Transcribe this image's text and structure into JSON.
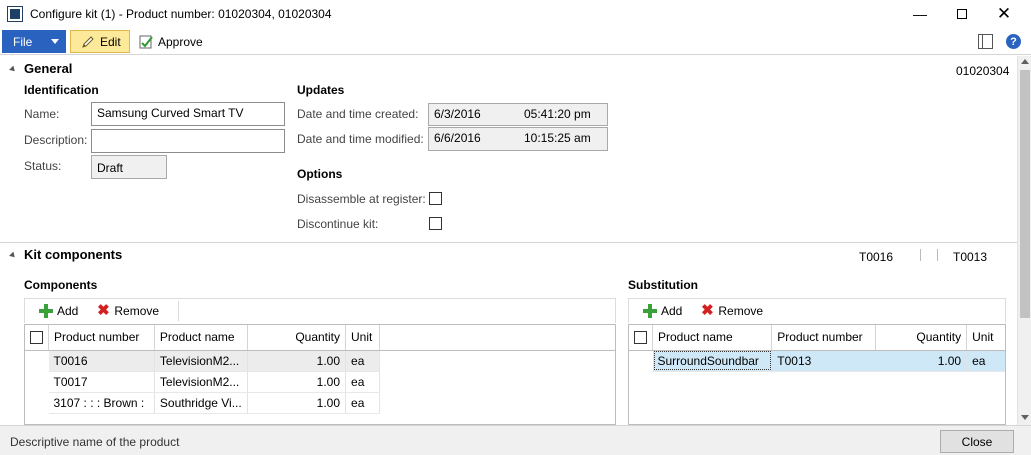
{
  "window": {
    "title": "Configure kit (1) - Product number: 01020304, 01020304"
  },
  "toolbar": {
    "file_label": "File",
    "edit_label": "Edit",
    "approve_label": "Approve"
  },
  "general": {
    "header": "General",
    "record_id": "01020304",
    "identification": {
      "title": "Identification",
      "name_label": "Name:",
      "name_value": "Samsung Curved Smart TV",
      "description_label": "Description:",
      "description_value": "",
      "status_label": "Status:",
      "status_value": "Draft"
    },
    "updates": {
      "title": "Updates",
      "created_label": "Date and time created:",
      "created_date": "6/3/2016",
      "created_time": "05:41:20 pm",
      "modified_label": "Date and time modified:",
      "modified_date": "6/6/2016",
      "modified_time": "10:15:25 am"
    },
    "options": {
      "title": "Options",
      "disassemble_label": "Disassemble at register:",
      "disassemble_checked": false,
      "discontinue_label": "Discontinue kit:",
      "discontinue_checked": false
    }
  },
  "kit_components": {
    "header": "Kit components",
    "summary": [
      "T0016",
      "T0013"
    ],
    "components": {
      "title": "Components",
      "add_label": "Add",
      "remove_label": "Remove",
      "columns": [
        "Product number",
        "Product name",
        "Quantity",
        "Unit"
      ],
      "rows": [
        {
          "product_number": "T0016",
          "product_name": "TelevisionM2...",
          "quantity": "1.00",
          "unit": "ea"
        },
        {
          "product_number": "T0017",
          "product_name": "TelevisionM2...",
          "quantity": "1.00",
          "unit": "ea"
        },
        {
          "product_number": "3107 : : : Brown :",
          "product_name": "Southridge Vi...",
          "quantity": "1.00",
          "unit": "ea"
        }
      ]
    },
    "substitution": {
      "title": "Substitution",
      "add_label": "Add",
      "remove_label": "Remove",
      "columns": [
        "Product name",
        "Product number",
        "Quantity",
        "Unit"
      ],
      "rows": [
        {
          "product_name": "SurroundSoundbar",
          "product_number": "T0013",
          "quantity": "1.00",
          "unit": "ea"
        }
      ]
    }
  },
  "statusbar": {
    "text": "Descriptive name of the product",
    "close_label": "Close"
  }
}
